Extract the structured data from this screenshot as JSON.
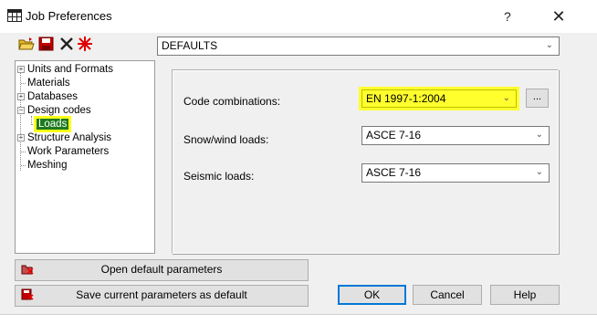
{
  "window": {
    "title": "Job Preferences",
    "help_label": "?",
    "close_label": "✕"
  },
  "toolbar": {
    "icons": [
      "open-folder-icon",
      "save-disk-icon",
      "delete-x-icon",
      "reset-star-icon"
    ]
  },
  "preset_combo": {
    "value": "DEFAULTS"
  },
  "tree": {
    "items": [
      {
        "label": "Units and Formats",
        "expandable": true,
        "level": 0
      },
      {
        "label": "Materials",
        "expandable": false,
        "level": 0
      },
      {
        "label": "Databases",
        "expandable": true,
        "level": 0
      },
      {
        "label": "Design codes",
        "expandable": true,
        "expanded": true,
        "level": 0
      },
      {
        "label": "Loads",
        "expandable": false,
        "level": 1,
        "selected": true
      },
      {
        "label": "Structure Analysis",
        "expandable": true,
        "level": 0
      },
      {
        "label": "Work Parameters",
        "expandable": false,
        "level": 0
      },
      {
        "label": "Meshing",
        "expandable": false,
        "level": 0
      }
    ]
  },
  "loads": {
    "code_combinations": {
      "label": "Code combinations:",
      "value": "EN 1997-1:2004",
      "more_label": "..."
    },
    "snow_wind": {
      "label": "Snow/wind loads:",
      "value": "ASCE 7-16"
    },
    "seismic": {
      "label": "Seismic loads:",
      "value": "ASCE 7-16"
    }
  },
  "buttons": {
    "open_default": "Open default parameters",
    "save_default": "Save current parameters as default",
    "ok": "OK",
    "cancel": "Cancel",
    "help": "Help"
  },
  "colors": {
    "highlight": "#ffff2e",
    "selected_bg": "#1e7a1e",
    "accent": "#0078d7"
  }
}
